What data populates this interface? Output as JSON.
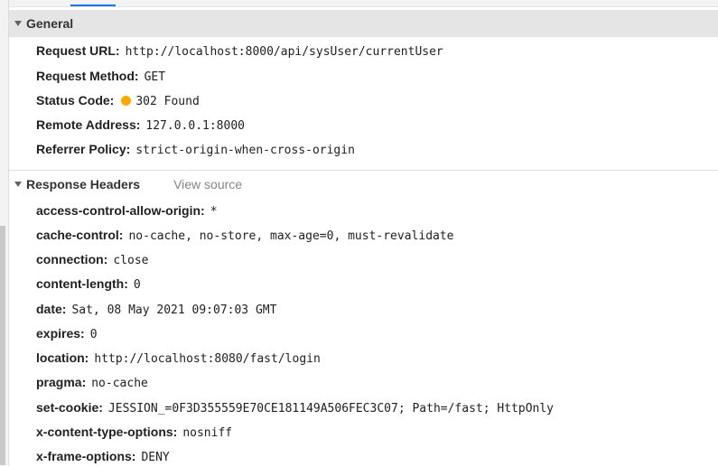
{
  "general": {
    "title": "General",
    "rows": [
      {
        "name": "Request URL:",
        "value": "http://localhost:8000/api/sysUser/currentUser"
      },
      {
        "name": "Request Method:",
        "value": "GET"
      },
      {
        "name": "Status Code:",
        "value": "302 Found",
        "status_color": "#f9ab00"
      },
      {
        "name": "Remote Address:",
        "value": "127.0.0.1:8000"
      },
      {
        "name": "Referrer Policy:",
        "value": "strict-origin-when-cross-origin"
      }
    ]
  },
  "response_headers": {
    "title": "Response Headers",
    "view_source": "View source",
    "rows": [
      {
        "name": "access-control-allow-origin:",
        "value": "*"
      },
      {
        "name": "cache-control:",
        "value": "no-cache, no-store, max-age=0, must-revalidate"
      },
      {
        "name": "connection:",
        "value": "close"
      },
      {
        "name": "content-length:",
        "value": "0"
      },
      {
        "name": "date:",
        "value": "Sat, 08 May 2021 09:07:03 GMT"
      },
      {
        "name": "expires:",
        "value": "0"
      },
      {
        "name": "location:",
        "value": "http://localhost:8080/fast/login"
      },
      {
        "name": "pragma:",
        "value": "no-cache"
      },
      {
        "name": "set-cookie:",
        "value": "JESSION_=0F3D355559E70CE181149A506FEC3C07; Path=/fast; HttpOnly"
      },
      {
        "name": "x-content-type-options:",
        "value": "nosniff"
      },
      {
        "name": "x-frame-options:",
        "value": "DENY"
      }
    ]
  }
}
